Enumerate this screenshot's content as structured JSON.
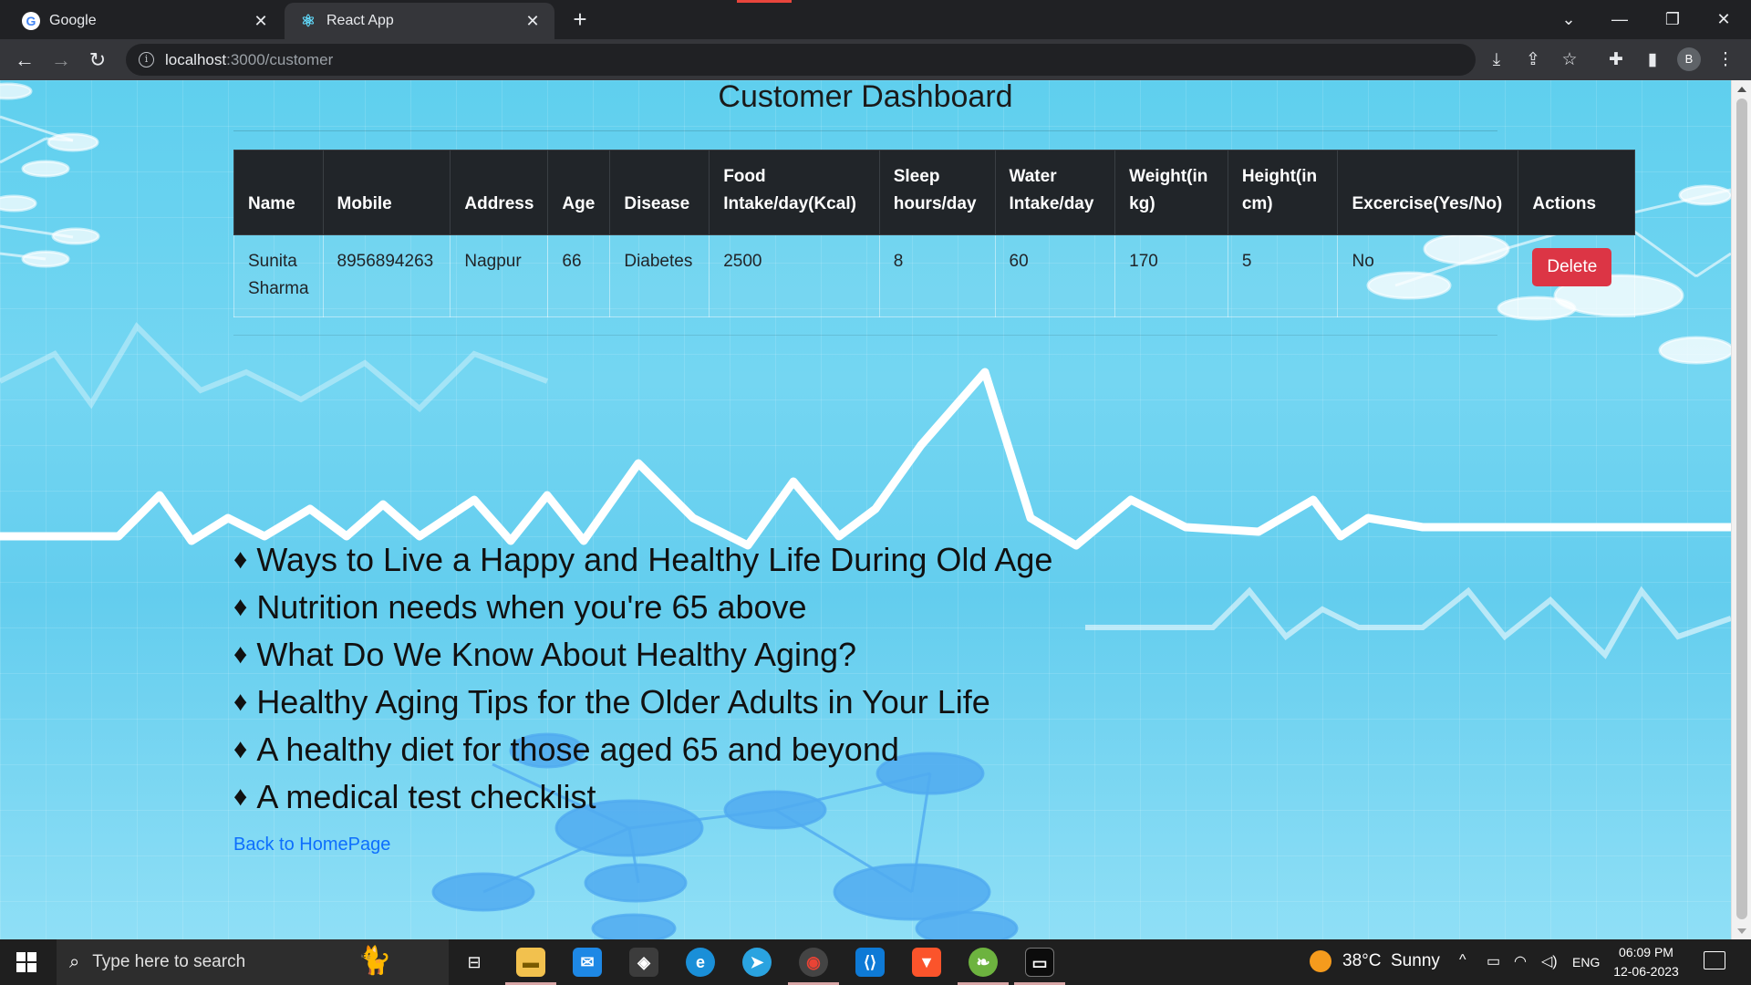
{
  "browser": {
    "tabs": [
      {
        "title": "Google",
        "favicon": "google-g-icon"
      },
      {
        "title": "React App",
        "favicon": "react-icon"
      }
    ],
    "url_host": "localhost",
    "url_path": ":3000/customer",
    "profile_initial": "B"
  },
  "page": {
    "title": "Customer Dashboard",
    "table": {
      "headers": [
        "Name",
        "Mobile",
        "Address",
        "Age",
        "Disease",
        "Food Intake/day(Kcal)",
        "Sleep hours/day",
        "Water Intake/day",
        "Weight(in kg)",
        "Height(in cm)",
        "Excercise(Yes/No)",
        "Actions"
      ],
      "rows": [
        {
          "name": "Sunita Sharma",
          "mobile": "8956894263",
          "address": "Nagpur",
          "age": "66",
          "disease": "Diabetes",
          "food": "2500",
          "sleep": "8",
          "water": "60",
          "weight": "170",
          "height": "5",
          "exercise": "No",
          "action_label": "Delete"
        }
      ]
    },
    "articles": [
      "Ways to Live a Happy and Healthy Life During Old Age",
      "Nutrition needs when you're 65 above",
      "What Do We Know About Healthy Aging?",
      "Healthy Aging Tips for the Older Adults in Your Life",
      "A healthy diet for those aged 65 and beyond",
      "A medical test checklist"
    ],
    "bullet": "♦",
    "back_link": "Back to HomePage"
  },
  "taskbar": {
    "search_placeholder": "Type here to search",
    "weather": "38°C  Sunny",
    "language": "ENG",
    "time": "06:09 PM",
    "date": "12-06-2023"
  },
  "colors": {
    "delete_button": "#dc3545",
    "table_header": "#212529",
    "link": "#0d6efd",
    "page_background": "#6dd3f0"
  }
}
